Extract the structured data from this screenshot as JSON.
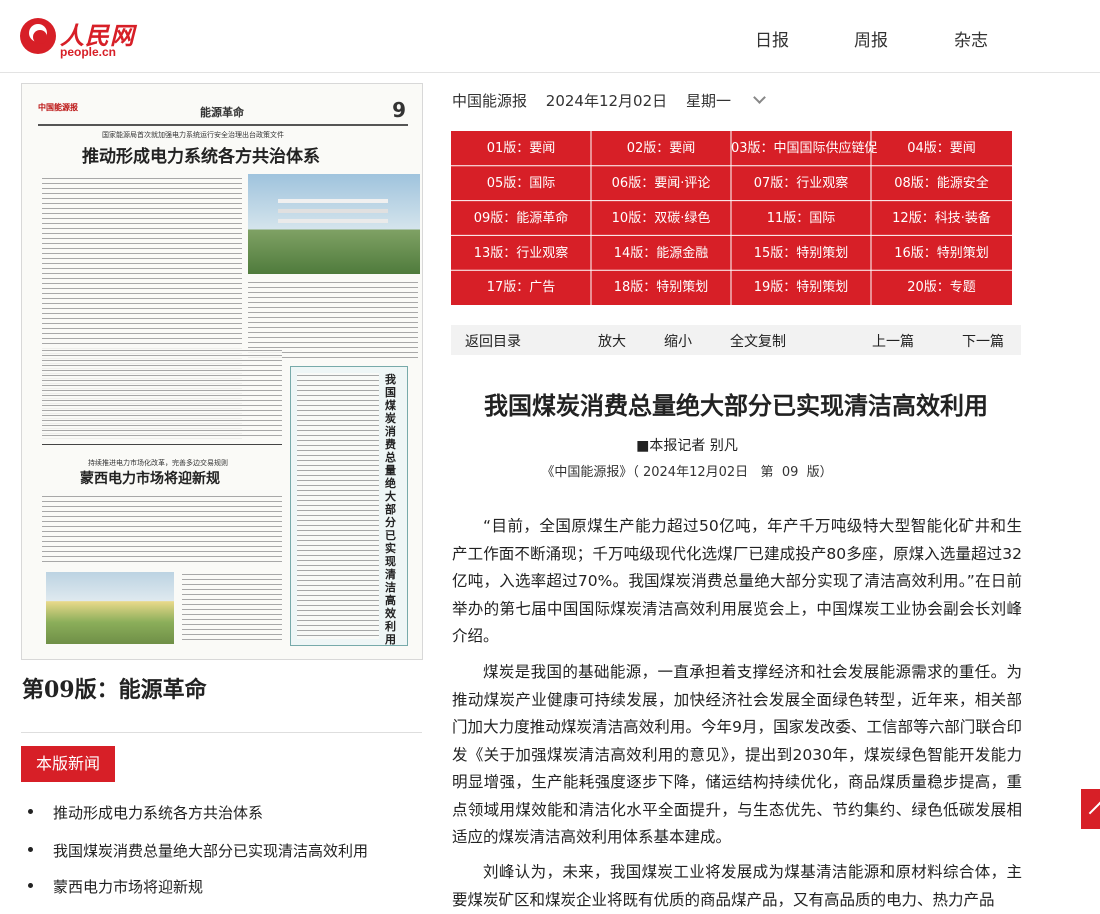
{
  "header": {
    "logo_text": "人民网",
    "logo_domain": "people.cn",
    "nav": [
      "日报",
      "周报",
      "杂志"
    ]
  },
  "paper": {
    "brand": "中国能源报",
    "section": "能源革命",
    "page_number": "9",
    "subtitle": "国家能源局首次就加强电力系统运行安全治理出台政策文件",
    "headline": "推动形成电力系统各方共治体系",
    "subtitle2": "持续推进电力市场化改革，完善多边交易规则",
    "headline2": "蒙西电力市场将迎新规",
    "vertical_headline": "我国煤炭消费总量绝大部分已实现清洁高效利用"
  },
  "edition_title": "第09版：能源革命",
  "news_section": {
    "badge": "本版新闻",
    "items": [
      "推动形成电力系统各方共治体系",
      "我国煤炭消费总量绝大部分已实现清洁高效利用",
      "蒙西电力市场将迎新规"
    ]
  },
  "dateline": {
    "paper": "中国能源报",
    "date": "2024年12月02日",
    "weekday": "星期一"
  },
  "editions": [
    "01版：要闻",
    "02版：要闻",
    "03版：中国国际供应链促",
    "04版：要闻",
    "05版：国际",
    "06版：要闻·评论",
    "07版：行业观察",
    "08版：能源安全",
    "09版：能源革命",
    "10版：双碳·绿色",
    "11版：国际",
    "12版：科技·装备",
    "13版：行业观察",
    "14版：能源金融",
    "15版：特别策划",
    "16版：特别策划",
    "17版：广告",
    "18版：特别策划",
    "19版：特别策划",
    "20版：专题"
  ],
  "toolbar": {
    "back": "返回目录",
    "zoom_in": "放大",
    "zoom_out": "缩小",
    "copy": "全文复制",
    "prev": "上一篇",
    "next": "下一篇"
  },
  "article": {
    "title": "我国煤炭消费总量绝大部分已实现清洁高效利用",
    "byline": "■本报记者 别凡",
    "source": "《中国能源报》（ 2024年12月02日   第  09  版）",
    "paragraphs": [
      "“目前，全国原煤生产能力超过50亿吨，年产千万吨级特大型智能化矿井和生产工作面不断涌现；千万吨级现代化选煤厂已建成投产80多座，原煤入选量超过32亿吨，入选率超过70%。我国煤炭消费总量绝大部分实现了清洁高效利用。”在日前举办的第七届中国国际煤炭清洁高效利用展览会上，中国煤炭工业协会副会长刘峰介绍。",
      "煤炭是我国的基础能源，一直承担着支撑经济和社会发展能源需求的重任。为推动煤炭产业健康可持续发展，加快经济社会发展全面绿色转型，近年来，相关部门加大力度推动煤炭清洁高效利用。今年9月，国家发改委、工信部等六部门联合印发《关于加强煤炭清洁高效利用的意见》，提出到2030年，煤炭绿色智能开发能力明显增强，生产能耗强度逐步下降，储运结构持续优化，商品煤质量稳步提高，重点领域用煤效能和清洁化水平全面提升，与生态优先、节约集约、绿色低碳发展相适应的煤炭清洁高效利用体系基本建成。",
      "刘峰认为，未来，我国煤炭工业将发展成为煤基清洁能源和原材料综合体，主要煤炭矿区和煤炭企业将既有优质的商品煤产品，又有高品质的电力、热力产品"
    ]
  },
  "colors": {
    "brand_red": "#d71f27"
  }
}
